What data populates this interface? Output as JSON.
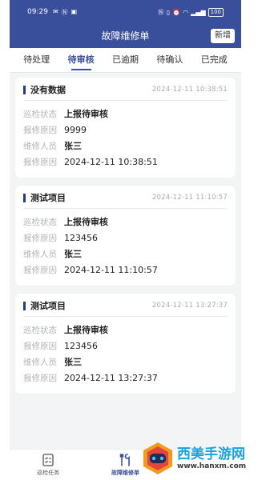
{
  "status_bar": {
    "time": "09:29",
    "left_icons": [
      "message-icon",
      "n-icon",
      "app-icon"
    ],
    "right_icons": [
      "nfc-icon",
      "vibrate-icon",
      "alarm-icon",
      "wifi-icon",
      "signal-icon"
    ],
    "battery": "100"
  },
  "header": {
    "title": "故障维修单",
    "add_label": "新增"
  },
  "tabs": [
    {
      "label": "待处理",
      "active": false
    },
    {
      "label": "待审核",
      "active": true
    },
    {
      "label": "已逾期",
      "active": false
    },
    {
      "label": "待确认",
      "active": false
    },
    {
      "label": "已完成",
      "active": false
    }
  ],
  "cards": [
    {
      "title": "没有数据",
      "time": "2024-12-11 10:38:51",
      "rows": [
        {
          "label": "巡检状态",
          "value": "上报待审核",
          "bold": true
        },
        {
          "label": "报修原因",
          "value": "9999",
          "bold": false
        },
        {
          "label": "维修人员",
          "value": "张三",
          "bold": true
        },
        {
          "label": "报修原因",
          "value": "2024-12-11 10:38:51",
          "bold": false
        }
      ]
    },
    {
      "title": "测试项目",
      "time": "2024-12-11 11:10:57",
      "rows": [
        {
          "label": "巡检状态",
          "value": "上报待审核",
          "bold": true
        },
        {
          "label": "报修原因",
          "value": "123456",
          "bold": false
        },
        {
          "label": "维修人员",
          "value": "张三",
          "bold": true
        },
        {
          "label": "报修原因",
          "value": "2024-12-11 11:10:57",
          "bold": false
        }
      ]
    },
    {
      "title": "测试项目",
      "time": "2024-12-11 13:27:37",
      "rows": [
        {
          "label": "巡检状态",
          "value": "上报待审核",
          "bold": true
        },
        {
          "label": "报修原因",
          "value": "123456",
          "bold": false
        },
        {
          "label": "维修人员",
          "value": "张三",
          "bold": true
        },
        {
          "label": "报修原因",
          "value": "2024-12-11 13:27:37",
          "bold": false
        }
      ]
    }
  ],
  "bottom_nav": [
    {
      "label": "巡检任务",
      "icon": "checklist-icon",
      "active": false
    },
    {
      "label": "故障维修单",
      "icon": "wrench-icon",
      "active": true
    }
  ],
  "watermark": {
    "name": "西美手游网",
    "url": "www.hanxm.com"
  },
  "colors": {
    "primary": "#3a4f9c",
    "background": "#f3f4f6",
    "label_gray": "#b2b4ba",
    "watermark_blue": "#1ba1e2"
  }
}
